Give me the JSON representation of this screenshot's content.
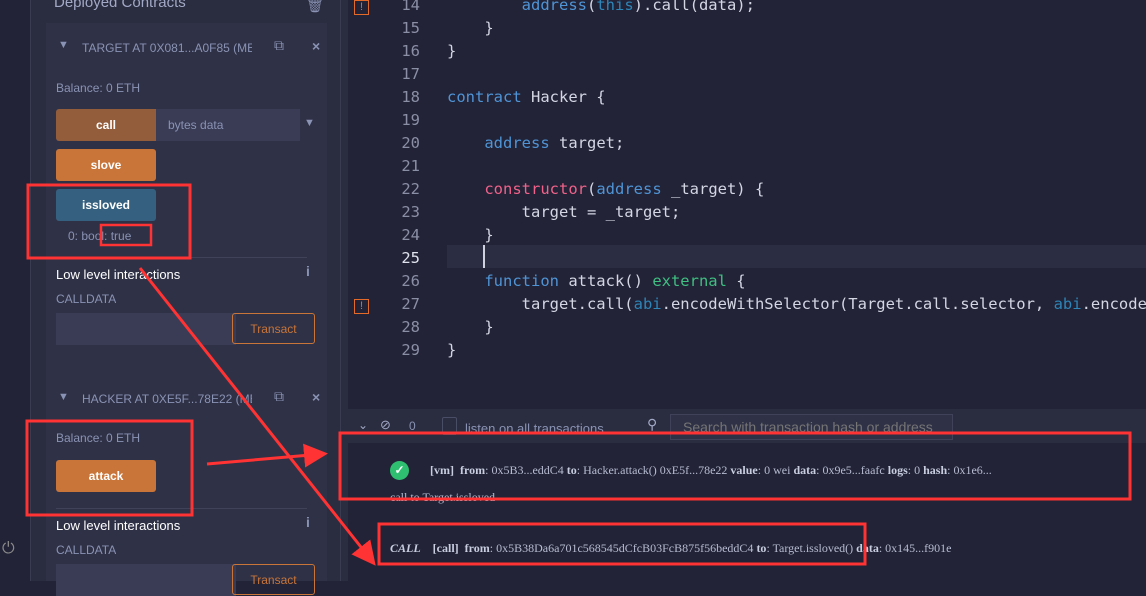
{
  "sidebar": {
    "section_title": "Deployed Contracts",
    "target": {
      "title": "TARGET AT 0X081...A0F85 (ME",
      "balance": "Balance: 0 ETH",
      "call_label": "call",
      "call_placeholder": "bytes data",
      "slove_label": "slove",
      "issloved_label": "issloved",
      "result_prefix": "0: bool:",
      "result_value": "true",
      "low_level": "Low level interactions",
      "calldata": "CALLDATA",
      "transact": "Transact"
    },
    "hacker": {
      "title": "HACKER AT 0XE5F...78E22 (ME",
      "balance": "Balance: 0 ETH",
      "attack_label": "attack",
      "low_level": "Low level interactions",
      "calldata": "CALLDATA",
      "transact": "Transact"
    }
  },
  "editor": {
    "lines": [
      {
        "n": "14",
        "warn": true,
        "t": [
          [
            "        ",
            ""
          ],
          [
            "address",
            "kw"
          ],
          [
            "(",
            ""
          ],
          [
            "this",
            "kb"
          ],
          [
            ").call(data);",
            ""
          ]
        ]
      },
      {
        "n": "15",
        "t": [
          [
            "    }",
            ""
          ]
        ]
      },
      {
        "n": "16",
        "t": [
          [
            "}",
            ""
          ]
        ]
      },
      {
        "n": "17",
        "t": []
      },
      {
        "n": "18",
        "t": [
          [
            "contract",
            "kw"
          ],
          [
            " Hacker {",
            ""
          ]
        ]
      },
      {
        "n": "19",
        "t": []
      },
      {
        "n": "20",
        "t": [
          [
            "    ",
            ""
          ],
          [
            "address",
            "kw"
          ],
          [
            " target;",
            ""
          ]
        ]
      },
      {
        "n": "21",
        "t": []
      },
      {
        "n": "22",
        "t": [
          [
            "    ",
            ""
          ],
          [
            "constructor",
            "kr"
          ],
          [
            "(",
            ""
          ],
          [
            "address",
            "kw"
          ],
          [
            " _target) {",
            ""
          ]
        ]
      },
      {
        "n": "23",
        "t": [
          [
            "        target = _target;",
            ""
          ]
        ]
      },
      {
        "n": "24",
        "t": [
          [
            "    }",
            ""
          ]
        ]
      },
      {
        "n": "25",
        "t": []
      },
      {
        "n": "26",
        "t": [
          [
            "    ",
            ""
          ],
          [
            "function",
            "kw"
          ],
          [
            " attack() ",
            ""
          ],
          [
            "external",
            "kg"
          ],
          [
            " {",
            ""
          ]
        ]
      },
      {
        "n": "27",
        "warn": true,
        "t": [
          [
            "        target.call(",
            ""
          ],
          [
            "abi",
            "kb"
          ],
          [
            ".encodeWithSelector(Target.call.selector, ",
            ""
          ],
          [
            "abi",
            "kb"
          ],
          [
            ".encode",
            ""
          ]
        ]
      },
      {
        "n": "28",
        "t": [
          [
            "    }",
            ""
          ]
        ]
      },
      {
        "n": "29",
        "t": [
          [
            "}",
            ""
          ]
        ]
      }
    ]
  },
  "terminal": {
    "count": "0",
    "listen_label": "listen on all transactions",
    "search_placeholder": "Search with transaction hash or address",
    "tx": {
      "tag": "[vm]",
      "from_k": "from",
      "from_v": "0x5B3...eddC4",
      "to_k": "to",
      "to_v": "Hacker.attack() 0xE5f...78e22",
      "value_k": "value",
      "value_v": "0 wei",
      "data_k": "data",
      "data_v": "0x9e5...faafc",
      "logs_k": "logs",
      "logs_v": "0",
      "hash_k": "hash",
      "hash_v": "0x1e6..."
    },
    "call_note": "call to Target.issloved",
    "call": {
      "label": "CALL",
      "tag": "[call]",
      "from_k": "from",
      "from_v": "0x5B38Da6a701c568545dCfcB03FcB875f56beddC4",
      "to_k": "to",
      "to_v": "Target.issloved()",
      "data_k": "data",
      "data_v": "0x145...f901e"
    }
  },
  "colors": {
    "accent_orange": "#c97539",
    "button_blue": "#35607f",
    "annotation_red": "#ff3333",
    "success_green": "#2fbf71"
  }
}
